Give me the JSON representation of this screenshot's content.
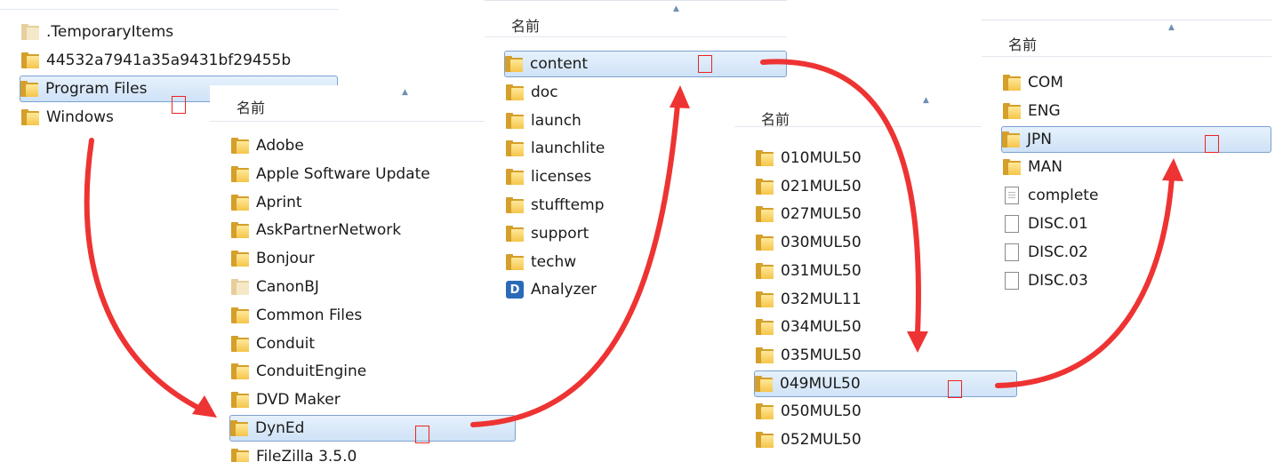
{
  "panels": {
    "root": {
      "items": [
        {
          "name": ".TemporaryItems",
          "icon": "folder-faded-icon"
        },
        {
          "name": "44532a7941a35a9431bf29455b",
          "icon": "folder-icon"
        },
        {
          "name": "Program Files",
          "icon": "folder-icon",
          "selected": true
        },
        {
          "name": "Windows",
          "icon": "folder-icon"
        }
      ]
    },
    "program_files": {
      "header": "名前",
      "items": [
        {
          "name": "Adobe"
        },
        {
          "name": "Apple Software Update"
        },
        {
          "name": "Aprint"
        },
        {
          "name": "AskPartnerNetwork"
        },
        {
          "name": "Bonjour"
        },
        {
          "name": "CanonBJ",
          "faded": true
        },
        {
          "name": "Common Files"
        },
        {
          "name": "Conduit"
        },
        {
          "name": "ConduitEngine"
        },
        {
          "name": "DVD Maker"
        },
        {
          "name": "DynEd",
          "selected": true
        },
        {
          "name": "FileZilla 3.5.0"
        }
      ]
    },
    "dyned": {
      "header": "名前",
      "items": [
        {
          "name": "content",
          "selected": true
        },
        {
          "name": "doc"
        },
        {
          "name": "launch"
        },
        {
          "name": "launchlite"
        },
        {
          "name": "licenses"
        },
        {
          "name": "stufftemp"
        },
        {
          "name": "support"
        },
        {
          "name": "techw"
        },
        {
          "name": "Analyzer",
          "icon": "app-icon",
          "glyph": "D"
        }
      ]
    },
    "content": {
      "header": "名前",
      "items": [
        {
          "name": "010MUL50"
        },
        {
          "name": "021MUL50"
        },
        {
          "name": "027MUL50"
        },
        {
          "name": "030MUL50"
        },
        {
          "name": "031MUL50"
        },
        {
          "name": "032MUL11"
        },
        {
          "name": "034MUL50"
        },
        {
          "name": "035MUL50"
        },
        {
          "name": "049MUL50",
          "selected": true
        },
        {
          "name": "050MUL50"
        },
        {
          "name": "052MUL50"
        }
      ]
    },
    "mul": {
      "header": "名前",
      "items": [
        {
          "name": "COM"
        },
        {
          "name": "ENG"
        },
        {
          "name": "JPN",
          "selected": true
        },
        {
          "name": "MAN"
        },
        {
          "name": "complete",
          "icon": "text-file-icon"
        },
        {
          "name": "DISC.01",
          "icon": "file-icon"
        },
        {
          "name": "DISC.02",
          "icon": "file-icon"
        },
        {
          "name": "DISC.03",
          "icon": "file-icon"
        }
      ]
    }
  },
  "colors": {
    "arrow": "#ee3333",
    "marker": "#ee2222",
    "selection": "#cfe2f7",
    "folder": "#f5c54a"
  }
}
